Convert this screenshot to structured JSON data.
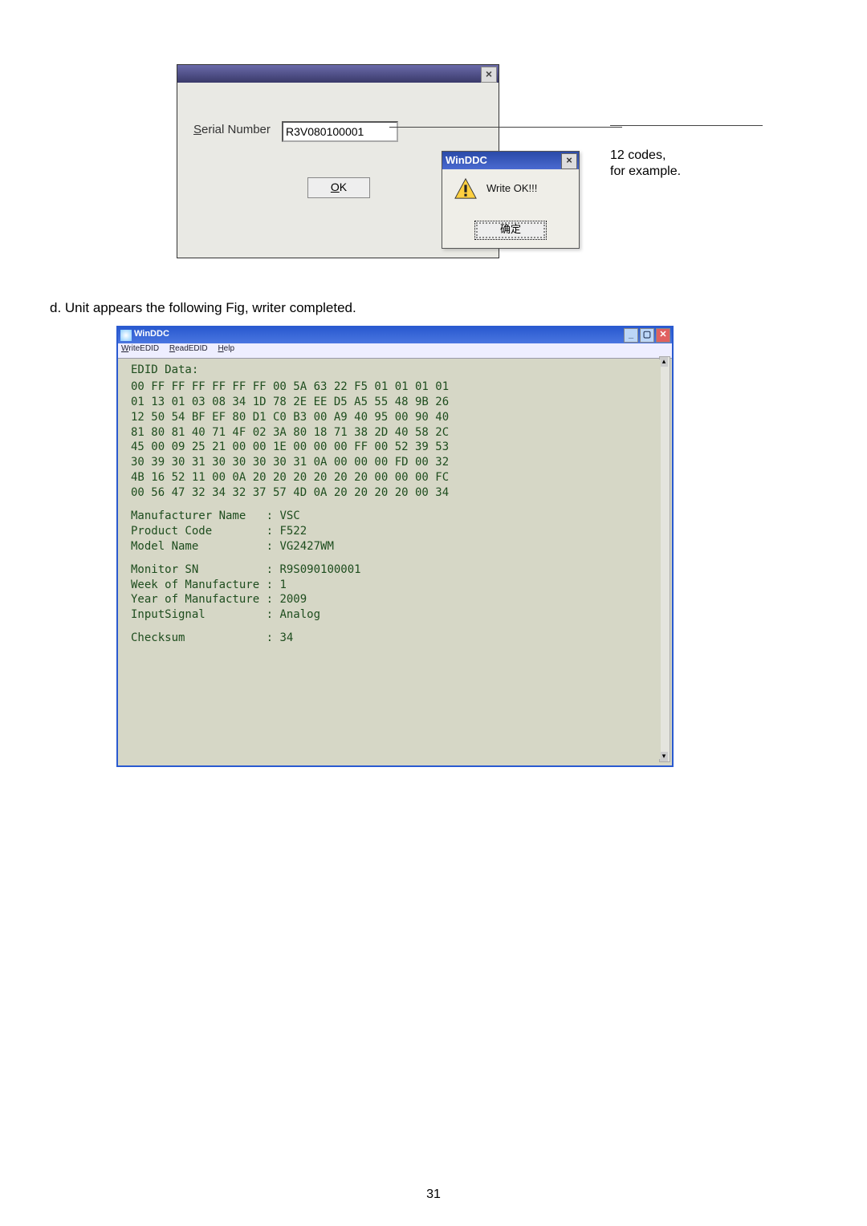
{
  "callout": {
    "text": "12 codes,\nfor example."
  },
  "dialog_serial": {
    "label_html": "Serial Number",
    "label_underline_char": "S",
    "input_value": "R3V080100001",
    "ok_label": "OK",
    "ok_underline_char": "O"
  },
  "msgbox": {
    "title": "WinDDC",
    "message": "Write OK!!!",
    "ok_label": "确定"
  },
  "paragraph_d": "d. Unit appears the following Fig, writer completed.",
  "windc_window": {
    "title": "WinDDC",
    "menu": {
      "write": "WriteEDID",
      "read": "ReadEDID",
      "help": "Help",
      "write_u": "W",
      "read_u": "R",
      "help_u": "H"
    },
    "edid_header": "EDID Data:",
    "edid_rows": [
      "00 FF FF FF FF FF FF 00 5A 63 22 F5 01 01 01 01",
      "01 13 01 03 08 34 1D 78 2E EE D5 A5 55 48 9B 26",
      "12 50 54 BF EF 80 D1 C0 B3 00 A9 40 95 00 90 40",
      "81 80 81 40 71 4F 02 3A 80 18 71 38 2D 40 58 2C",
      "45 00 09 25 21 00 00 1E 00 00 00 FF 00 52 39 53",
      "30 39 30 31 30 30 30 30 31 0A 00 00 00 FD 00 32",
      "4B 16 52 11 00 0A 20 20 20 20 20 20 00 00 00 FC",
      "00 56 47 32 34 32 37 57 4D 0A 20 20 20 20 00 34"
    ],
    "info": {
      "Manufacturer Name": "VSC",
      "Product Code": "F522",
      "Model Name": "VG2427WM",
      "Monitor SN": "R9S090100001",
      "Week of Manufacture": "1",
      "Year of Manufacture": "2009",
      "InputSignal": "Analog",
      "Checksum": "34"
    }
  },
  "page_number": "31"
}
